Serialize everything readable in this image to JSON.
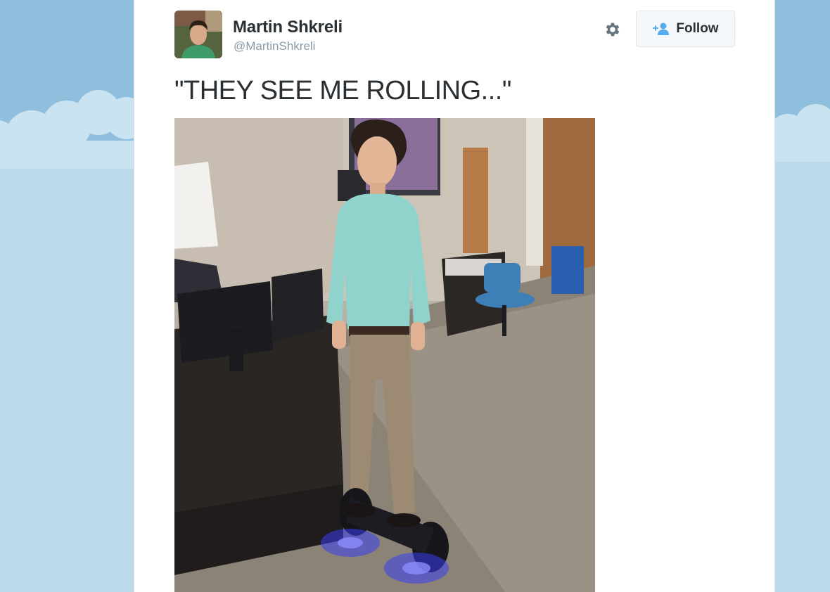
{
  "tweet": {
    "author": {
      "name": "Martin Shkreli",
      "handle": "@MartinShkreli",
      "avatar_icon": "avatar-photo"
    },
    "settings_icon": "gear-icon",
    "follow": {
      "label": "Follow",
      "icon": "add-user-icon",
      "icon_color": "#55acee"
    },
    "text": "\"THEY SEE ME ROLLING...\"",
    "media": {
      "alt": "Photo of a man standing on a hoverboard with blue lights in an office"
    }
  },
  "colors": {
    "background_sky": "#8fbfdc",
    "card": "#ffffff",
    "text_primary": "#292f33",
    "text_secondary": "#8899a6"
  }
}
